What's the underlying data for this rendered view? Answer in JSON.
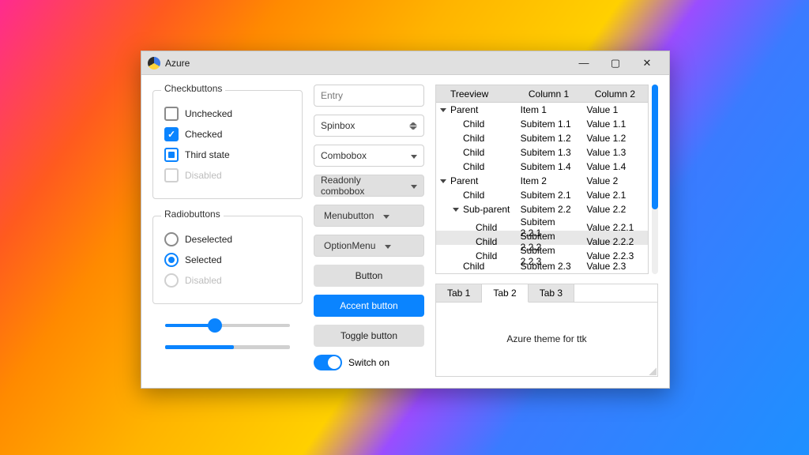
{
  "window": {
    "title": "Azure"
  },
  "checkbuttons": {
    "legend": "Checkbuttons",
    "items": [
      {
        "label": "Unchecked",
        "state": "unchecked"
      },
      {
        "label": "Checked",
        "state": "checked"
      },
      {
        "label": "Third state",
        "state": "third"
      },
      {
        "label": "Disabled",
        "state": "disabled"
      }
    ]
  },
  "radiobuttons": {
    "legend": "Radiobuttons",
    "items": [
      {
        "label": "Deselected",
        "state": "deselected"
      },
      {
        "label": "Selected",
        "state": "selected"
      },
      {
        "label": "Disabled",
        "state": "disabled"
      }
    ]
  },
  "scale": {
    "value": 40
  },
  "progress": {
    "value": 55
  },
  "entry": {
    "placeholder": "Entry"
  },
  "spinbox": {
    "label": "Spinbox"
  },
  "combobox": {
    "label": "Combobox"
  },
  "readonly_combobox": {
    "label": "Readonly combobox"
  },
  "menubutton": {
    "label": "Menubutton"
  },
  "optionmenu": {
    "label": "OptionMenu"
  },
  "button": {
    "label": "Button"
  },
  "accent_button": {
    "label": "Accent button"
  },
  "toggle_button": {
    "label": "Toggle button"
  },
  "switch": {
    "label": "Switch on",
    "on": true
  },
  "treeview": {
    "columns": [
      "Treeview",
      "Column 1",
      "Column 2"
    ],
    "rows": [
      {
        "depth": 0,
        "expand": "open",
        "c0": "Parent",
        "c1": "Item 1",
        "c2": "Value 1"
      },
      {
        "depth": 1,
        "c0": "Child",
        "c1": "Subitem 1.1",
        "c2": "Value 1.1"
      },
      {
        "depth": 1,
        "c0": "Child",
        "c1": "Subitem 1.2",
        "c2": "Value 1.2"
      },
      {
        "depth": 1,
        "c0": "Child",
        "c1": "Subitem 1.3",
        "c2": "Value 1.3"
      },
      {
        "depth": 1,
        "c0": "Child",
        "c1": "Subitem 1.4",
        "c2": "Value 1.4"
      },
      {
        "depth": 0,
        "expand": "open",
        "c0": "Parent",
        "c1": "Item 2",
        "c2": "Value 2"
      },
      {
        "depth": 1,
        "c0": "Child",
        "c1": "Subitem 2.1",
        "c2": "Value 2.1"
      },
      {
        "depth": 1,
        "expand": "open",
        "c0": "Sub-parent",
        "c1": "Subitem 2.2",
        "c2": "Value 2.2"
      },
      {
        "depth": 2,
        "c0": "Child",
        "c1": "Subitem 2.2.1",
        "c2": "Value 2.2.1"
      },
      {
        "depth": 2,
        "c0": "Child",
        "c1": "Subitem 2.2.2",
        "c2": "Value 2.2.2",
        "selected": true
      },
      {
        "depth": 2,
        "c0": "Child",
        "c1": "Subitem 2.2.3",
        "c2": "Value 2.2.3"
      },
      {
        "depth": 1,
        "c0": "Child",
        "c1": "Subitem 2.3",
        "c2": "Value 2.3"
      }
    ]
  },
  "tabs": {
    "items": [
      "Tab 1",
      "Tab 2",
      "Tab 3"
    ],
    "active": 1,
    "body": "Azure theme for ttk"
  },
  "colors": {
    "accent": "#0a84ff"
  }
}
